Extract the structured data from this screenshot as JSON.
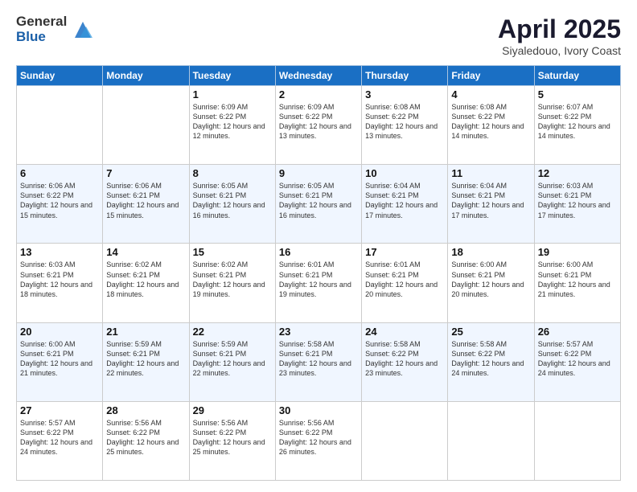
{
  "header": {
    "logo_general": "General",
    "logo_blue": "Blue",
    "title": "April 2025",
    "location": "Siyaledouo, Ivory Coast"
  },
  "days_of_week": [
    "Sunday",
    "Monday",
    "Tuesday",
    "Wednesday",
    "Thursday",
    "Friday",
    "Saturday"
  ],
  "weeks": [
    [
      {
        "day": "",
        "sunrise": "",
        "sunset": "",
        "daylight": ""
      },
      {
        "day": "",
        "sunrise": "",
        "sunset": "",
        "daylight": ""
      },
      {
        "day": "1",
        "sunrise": "Sunrise: 6:09 AM",
        "sunset": "Sunset: 6:22 PM",
        "daylight": "Daylight: 12 hours and 12 minutes."
      },
      {
        "day": "2",
        "sunrise": "Sunrise: 6:09 AM",
        "sunset": "Sunset: 6:22 PM",
        "daylight": "Daylight: 12 hours and 13 minutes."
      },
      {
        "day": "3",
        "sunrise": "Sunrise: 6:08 AM",
        "sunset": "Sunset: 6:22 PM",
        "daylight": "Daylight: 12 hours and 13 minutes."
      },
      {
        "day": "4",
        "sunrise": "Sunrise: 6:08 AM",
        "sunset": "Sunset: 6:22 PM",
        "daylight": "Daylight: 12 hours and 14 minutes."
      },
      {
        "day": "5",
        "sunrise": "Sunrise: 6:07 AM",
        "sunset": "Sunset: 6:22 PM",
        "daylight": "Daylight: 12 hours and 14 minutes."
      }
    ],
    [
      {
        "day": "6",
        "sunrise": "Sunrise: 6:06 AM",
        "sunset": "Sunset: 6:22 PM",
        "daylight": "Daylight: 12 hours and 15 minutes."
      },
      {
        "day": "7",
        "sunrise": "Sunrise: 6:06 AM",
        "sunset": "Sunset: 6:21 PM",
        "daylight": "Daylight: 12 hours and 15 minutes."
      },
      {
        "day": "8",
        "sunrise": "Sunrise: 6:05 AM",
        "sunset": "Sunset: 6:21 PM",
        "daylight": "Daylight: 12 hours and 16 minutes."
      },
      {
        "day": "9",
        "sunrise": "Sunrise: 6:05 AM",
        "sunset": "Sunset: 6:21 PM",
        "daylight": "Daylight: 12 hours and 16 minutes."
      },
      {
        "day": "10",
        "sunrise": "Sunrise: 6:04 AM",
        "sunset": "Sunset: 6:21 PM",
        "daylight": "Daylight: 12 hours and 17 minutes."
      },
      {
        "day": "11",
        "sunrise": "Sunrise: 6:04 AM",
        "sunset": "Sunset: 6:21 PM",
        "daylight": "Daylight: 12 hours and 17 minutes."
      },
      {
        "day": "12",
        "sunrise": "Sunrise: 6:03 AM",
        "sunset": "Sunset: 6:21 PM",
        "daylight": "Daylight: 12 hours and 17 minutes."
      }
    ],
    [
      {
        "day": "13",
        "sunrise": "Sunrise: 6:03 AM",
        "sunset": "Sunset: 6:21 PM",
        "daylight": "Daylight: 12 hours and 18 minutes."
      },
      {
        "day": "14",
        "sunrise": "Sunrise: 6:02 AM",
        "sunset": "Sunset: 6:21 PM",
        "daylight": "Daylight: 12 hours and 18 minutes."
      },
      {
        "day": "15",
        "sunrise": "Sunrise: 6:02 AM",
        "sunset": "Sunset: 6:21 PM",
        "daylight": "Daylight: 12 hours and 19 minutes."
      },
      {
        "day": "16",
        "sunrise": "Sunrise: 6:01 AM",
        "sunset": "Sunset: 6:21 PM",
        "daylight": "Daylight: 12 hours and 19 minutes."
      },
      {
        "day": "17",
        "sunrise": "Sunrise: 6:01 AM",
        "sunset": "Sunset: 6:21 PM",
        "daylight": "Daylight: 12 hours and 20 minutes."
      },
      {
        "day": "18",
        "sunrise": "Sunrise: 6:00 AM",
        "sunset": "Sunset: 6:21 PM",
        "daylight": "Daylight: 12 hours and 20 minutes."
      },
      {
        "day": "19",
        "sunrise": "Sunrise: 6:00 AM",
        "sunset": "Sunset: 6:21 PM",
        "daylight": "Daylight: 12 hours and 21 minutes."
      }
    ],
    [
      {
        "day": "20",
        "sunrise": "Sunrise: 6:00 AM",
        "sunset": "Sunset: 6:21 PM",
        "daylight": "Daylight: 12 hours and 21 minutes."
      },
      {
        "day": "21",
        "sunrise": "Sunrise: 5:59 AM",
        "sunset": "Sunset: 6:21 PM",
        "daylight": "Daylight: 12 hours and 22 minutes."
      },
      {
        "day": "22",
        "sunrise": "Sunrise: 5:59 AM",
        "sunset": "Sunset: 6:21 PM",
        "daylight": "Daylight: 12 hours and 22 minutes."
      },
      {
        "day": "23",
        "sunrise": "Sunrise: 5:58 AM",
        "sunset": "Sunset: 6:21 PM",
        "daylight": "Daylight: 12 hours and 23 minutes."
      },
      {
        "day": "24",
        "sunrise": "Sunrise: 5:58 AM",
        "sunset": "Sunset: 6:22 PM",
        "daylight": "Daylight: 12 hours and 23 minutes."
      },
      {
        "day": "25",
        "sunrise": "Sunrise: 5:58 AM",
        "sunset": "Sunset: 6:22 PM",
        "daylight": "Daylight: 12 hours and 24 minutes."
      },
      {
        "day": "26",
        "sunrise": "Sunrise: 5:57 AM",
        "sunset": "Sunset: 6:22 PM",
        "daylight": "Daylight: 12 hours and 24 minutes."
      }
    ],
    [
      {
        "day": "27",
        "sunrise": "Sunrise: 5:57 AM",
        "sunset": "Sunset: 6:22 PM",
        "daylight": "Daylight: 12 hours and 24 minutes."
      },
      {
        "day": "28",
        "sunrise": "Sunrise: 5:56 AM",
        "sunset": "Sunset: 6:22 PM",
        "daylight": "Daylight: 12 hours and 25 minutes."
      },
      {
        "day": "29",
        "sunrise": "Sunrise: 5:56 AM",
        "sunset": "Sunset: 6:22 PM",
        "daylight": "Daylight: 12 hours and 25 minutes."
      },
      {
        "day": "30",
        "sunrise": "Sunrise: 5:56 AM",
        "sunset": "Sunset: 6:22 PM",
        "daylight": "Daylight: 12 hours and 26 minutes."
      },
      {
        "day": "",
        "sunrise": "",
        "sunset": "",
        "daylight": ""
      },
      {
        "day": "",
        "sunrise": "",
        "sunset": "",
        "daylight": ""
      },
      {
        "day": "",
        "sunrise": "",
        "sunset": "",
        "daylight": ""
      }
    ]
  ]
}
